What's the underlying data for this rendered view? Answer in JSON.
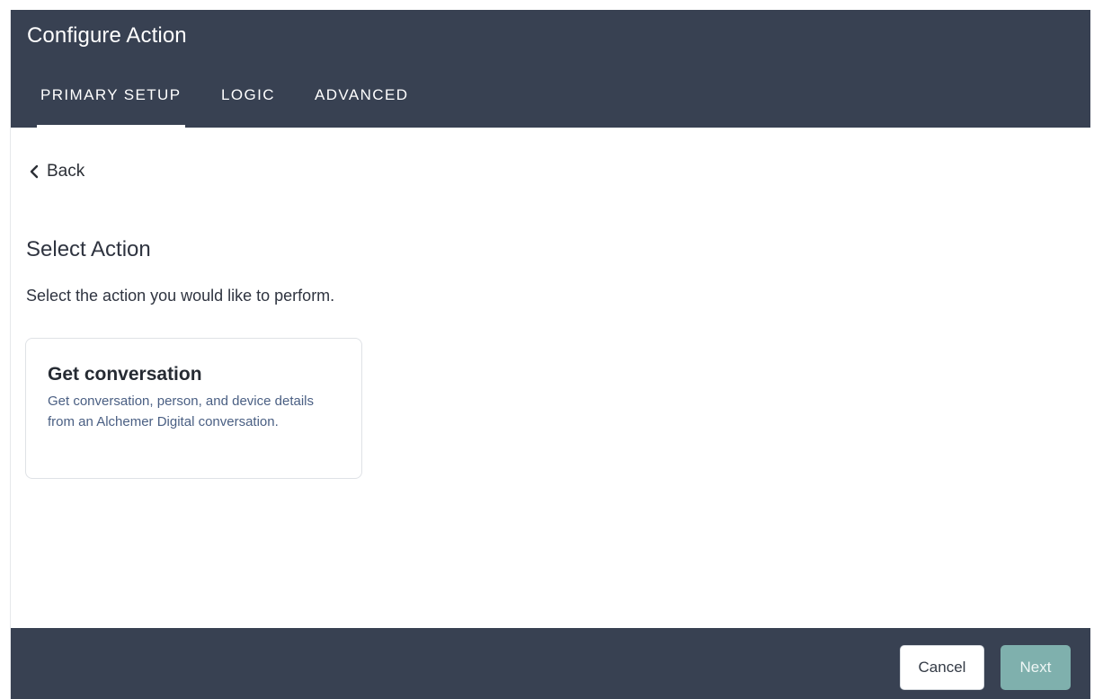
{
  "header": {
    "title": "Configure Action",
    "tabs": [
      {
        "label": "PRIMARY SETUP",
        "active": true
      },
      {
        "label": "LOGIC",
        "active": false
      },
      {
        "label": "ADVANCED",
        "active": false
      }
    ]
  },
  "nav": {
    "back_label": "Back",
    "back_icon": "chevron-left-icon"
  },
  "main": {
    "section_title": "Select Action",
    "section_description": "Select the action you would like to perform.",
    "action_cards": [
      {
        "title": "Get conversation",
        "description": "Get conversation, person, and device details from an Alchemer Digital conversation."
      }
    ]
  },
  "footer": {
    "cancel_label": "Cancel",
    "next_label": "Next",
    "next_enabled": false
  },
  "colors": {
    "header_bg": "#384152",
    "footer_bg": "#384152",
    "next_button_bg": "#7fb0ad",
    "card_description": "#4a5f83"
  }
}
